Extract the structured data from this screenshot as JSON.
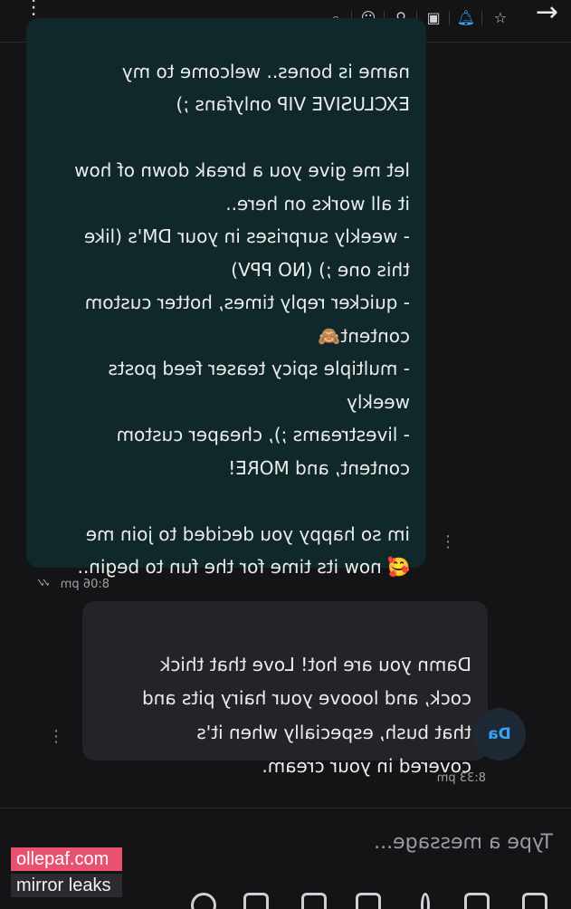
{
  "incoming_message": {
    "text_lines": [
      "name is bones.. welcome to my",
      "EXCLUSIVE VIP onlyfans ;)",
      "",
      "let me give you a break down of how",
      "it all works on here..",
      "- weekly surprises in your DM's (like",
      "this one ;) (NO PPV)",
      "- quicker reply times, hotter custom",
      "content🙈",
      "- multiple spicy teaser feed posts",
      "weekly",
      "- livestreams ;), cheaper custom",
      "content, and MORE!",
      "",
      "im so happy you decided to join me",
      "🥰 now its time for the fun to begin.."
    ],
    "time": "8:06 pm"
  },
  "outgoing_message": {
    "text_lines": [
      "Damn you are hot! Love that thick",
      "cock, and looove your hairy pits and",
      "that bush, especially when it's",
      "covered in your cream."
    ],
    "time": "8:33 pm",
    "avatar_initials": "Da"
  },
  "composer": {
    "placeholder": "Type a message..."
  },
  "toolbar": {
    "icons": [
      "search-icon",
      "emoji-icon",
      "pin-icon",
      "tag-icon",
      "bell-icon",
      "star-icon"
    ],
    "accent_color": "#3aa2f0"
  },
  "watermark": {
    "line1": "ollepaf.com",
    "line2": "mirror leaks"
  }
}
